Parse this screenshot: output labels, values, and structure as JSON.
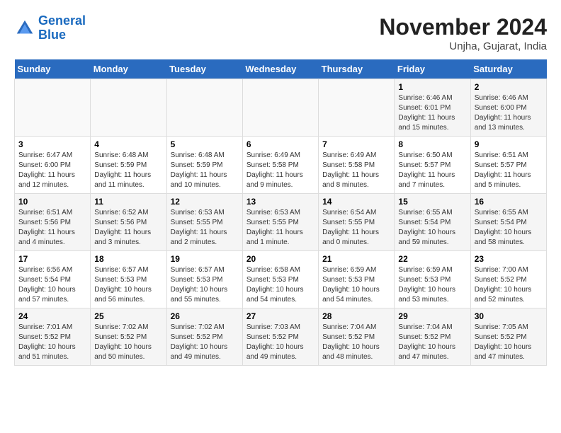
{
  "header": {
    "logo_line1": "General",
    "logo_line2": "Blue",
    "month_title": "November 2024",
    "location": "Unjha, Gujarat, India"
  },
  "days_of_week": [
    "Sunday",
    "Monday",
    "Tuesday",
    "Wednesday",
    "Thursday",
    "Friday",
    "Saturday"
  ],
  "weeks": [
    [
      {
        "day": "",
        "info": ""
      },
      {
        "day": "",
        "info": ""
      },
      {
        "day": "",
        "info": ""
      },
      {
        "day": "",
        "info": ""
      },
      {
        "day": "",
        "info": ""
      },
      {
        "day": "1",
        "info": "Sunrise: 6:46 AM\nSunset: 6:01 PM\nDaylight: 11 hours and 15 minutes."
      },
      {
        "day": "2",
        "info": "Sunrise: 6:46 AM\nSunset: 6:00 PM\nDaylight: 11 hours and 13 minutes."
      }
    ],
    [
      {
        "day": "3",
        "info": "Sunrise: 6:47 AM\nSunset: 6:00 PM\nDaylight: 11 hours and 12 minutes."
      },
      {
        "day": "4",
        "info": "Sunrise: 6:48 AM\nSunset: 5:59 PM\nDaylight: 11 hours and 11 minutes."
      },
      {
        "day": "5",
        "info": "Sunrise: 6:48 AM\nSunset: 5:59 PM\nDaylight: 11 hours and 10 minutes."
      },
      {
        "day": "6",
        "info": "Sunrise: 6:49 AM\nSunset: 5:58 PM\nDaylight: 11 hours and 9 minutes."
      },
      {
        "day": "7",
        "info": "Sunrise: 6:49 AM\nSunset: 5:58 PM\nDaylight: 11 hours and 8 minutes."
      },
      {
        "day": "8",
        "info": "Sunrise: 6:50 AM\nSunset: 5:57 PM\nDaylight: 11 hours and 7 minutes."
      },
      {
        "day": "9",
        "info": "Sunrise: 6:51 AM\nSunset: 5:57 PM\nDaylight: 11 hours and 5 minutes."
      }
    ],
    [
      {
        "day": "10",
        "info": "Sunrise: 6:51 AM\nSunset: 5:56 PM\nDaylight: 11 hours and 4 minutes."
      },
      {
        "day": "11",
        "info": "Sunrise: 6:52 AM\nSunset: 5:56 PM\nDaylight: 11 hours and 3 minutes."
      },
      {
        "day": "12",
        "info": "Sunrise: 6:53 AM\nSunset: 5:55 PM\nDaylight: 11 hours and 2 minutes."
      },
      {
        "day": "13",
        "info": "Sunrise: 6:53 AM\nSunset: 5:55 PM\nDaylight: 11 hours and 1 minute."
      },
      {
        "day": "14",
        "info": "Sunrise: 6:54 AM\nSunset: 5:55 PM\nDaylight: 11 hours and 0 minutes."
      },
      {
        "day": "15",
        "info": "Sunrise: 6:55 AM\nSunset: 5:54 PM\nDaylight: 10 hours and 59 minutes."
      },
      {
        "day": "16",
        "info": "Sunrise: 6:55 AM\nSunset: 5:54 PM\nDaylight: 10 hours and 58 minutes."
      }
    ],
    [
      {
        "day": "17",
        "info": "Sunrise: 6:56 AM\nSunset: 5:54 PM\nDaylight: 10 hours and 57 minutes."
      },
      {
        "day": "18",
        "info": "Sunrise: 6:57 AM\nSunset: 5:53 PM\nDaylight: 10 hours and 56 minutes."
      },
      {
        "day": "19",
        "info": "Sunrise: 6:57 AM\nSunset: 5:53 PM\nDaylight: 10 hours and 55 minutes."
      },
      {
        "day": "20",
        "info": "Sunrise: 6:58 AM\nSunset: 5:53 PM\nDaylight: 10 hours and 54 minutes."
      },
      {
        "day": "21",
        "info": "Sunrise: 6:59 AM\nSunset: 5:53 PM\nDaylight: 10 hours and 54 minutes."
      },
      {
        "day": "22",
        "info": "Sunrise: 6:59 AM\nSunset: 5:53 PM\nDaylight: 10 hours and 53 minutes."
      },
      {
        "day": "23",
        "info": "Sunrise: 7:00 AM\nSunset: 5:52 PM\nDaylight: 10 hours and 52 minutes."
      }
    ],
    [
      {
        "day": "24",
        "info": "Sunrise: 7:01 AM\nSunset: 5:52 PM\nDaylight: 10 hours and 51 minutes."
      },
      {
        "day": "25",
        "info": "Sunrise: 7:02 AM\nSunset: 5:52 PM\nDaylight: 10 hours and 50 minutes."
      },
      {
        "day": "26",
        "info": "Sunrise: 7:02 AM\nSunset: 5:52 PM\nDaylight: 10 hours and 49 minutes."
      },
      {
        "day": "27",
        "info": "Sunrise: 7:03 AM\nSunset: 5:52 PM\nDaylight: 10 hours and 49 minutes."
      },
      {
        "day": "28",
        "info": "Sunrise: 7:04 AM\nSunset: 5:52 PM\nDaylight: 10 hours and 48 minutes."
      },
      {
        "day": "29",
        "info": "Sunrise: 7:04 AM\nSunset: 5:52 PM\nDaylight: 10 hours and 47 minutes."
      },
      {
        "day": "30",
        "info": "Sunrise: 7:05 AM\nSunset: 5:52 PM\nDaylight: 10 hours and 47 minutes."
      }
    ]
  ]
}
